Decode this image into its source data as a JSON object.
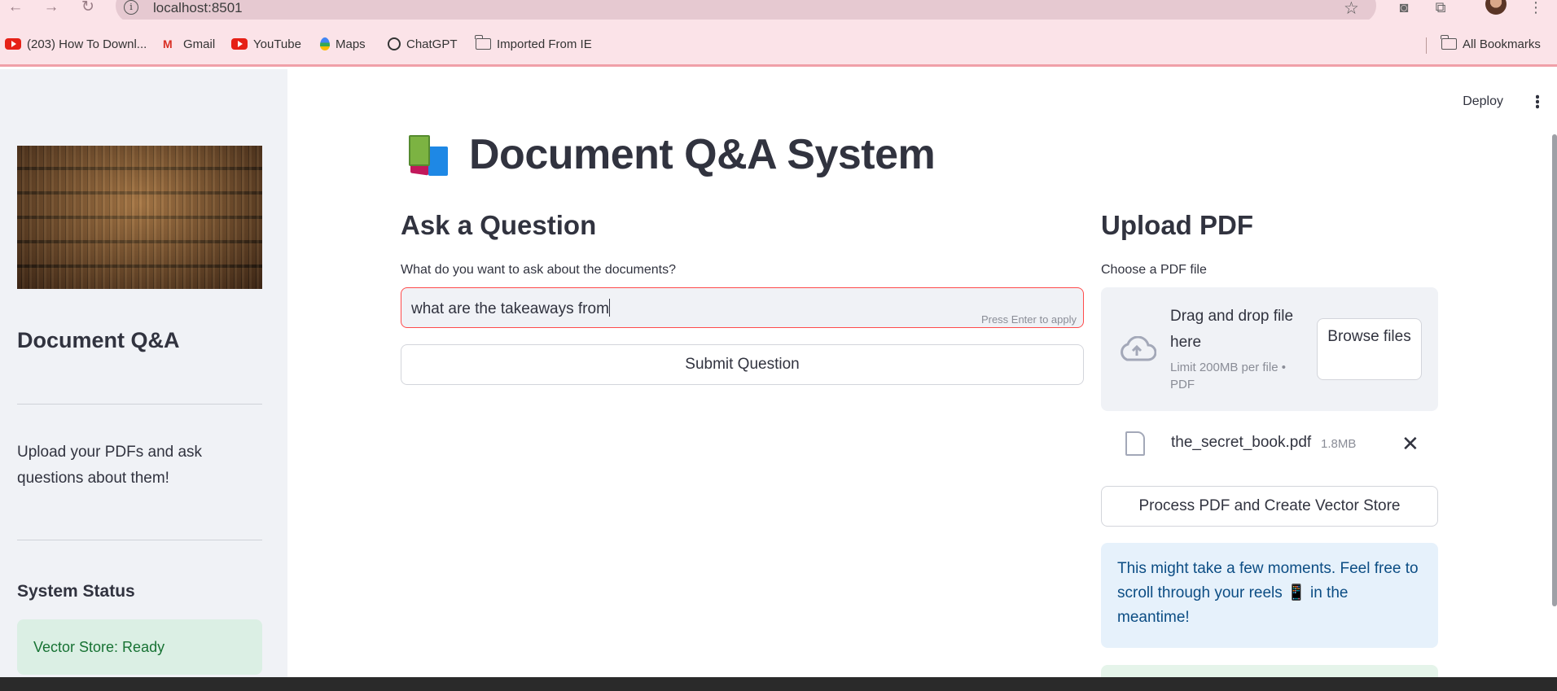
{
  "browser": {
    "url": "localhost:8501",
    "info_icon": "info-icon",
    "bookmarks": [
      {
        "label": "(203) How To Downl...",
        "icon": "youtube-icon"
      },
      {
        "label": "Gmail",
        "icon": "gmail-icon"
      },
      {
        "label": "YouTube",
        "icon": "youtube-icon"
      },
      {
        "label": "Maps",
        "icon": "maps-pin-icon"
      },
      {
        "label": "ChatGPT",
        "icon": "chatgpt-icon"
      },
      {
        "label": "Imported From IE",
        "icon": "folder-icon"
      }
    ],
    "all_bookmarks": "All Bookmarks"
  },
  "header": {
    "deploy": "Deploy"
  },
  "sidebar": {
    "title": "Document Q&A",
    "description": "Upload your PDFs and ask questions about them!",
    "status_heading": "System Status",
    "status_text": "Vector Store: Ready"
  },
  "main": {
    "title": "Document Q&A System",
    "title_icon": "books-icon",
    "ask": {
      "heading": "Ask a Question",
      "label": "What do you want to ask about the documents?",
      "value": "what are the takeaways from",
      "hint": "Press Enter to apply",
      "submit": "Submit Question"
    },
    "upload": {
      "heading": "Upload PDF",
      "label": "Choose a PDF file",
      "drop_text": "Drag and drop file here",
      "limit": "Limit 200MB per file • PDF",
      "browse": "Browse files",
      "file_name": "the_secret_book.pdf",
      "file_size": "1.8MB",
      "process_button": "Process PDF and Create Vector Store",
      "info": "This might take a few moments. Feel free to scroll through your reels 📱 in the meantime!"
    }
  },
  "colors": {
    "primary_red": "#ff4b4b",
    "sidebar_bg": "#f0f2f6",
    "success_bg": "#dbefe4",
    "success_text": "#177233",
    "info_bg": "#e6f1fb",
    "info_text": "#0c4d84",
    "browser_bg": "#fbe3e8"
  }
}
